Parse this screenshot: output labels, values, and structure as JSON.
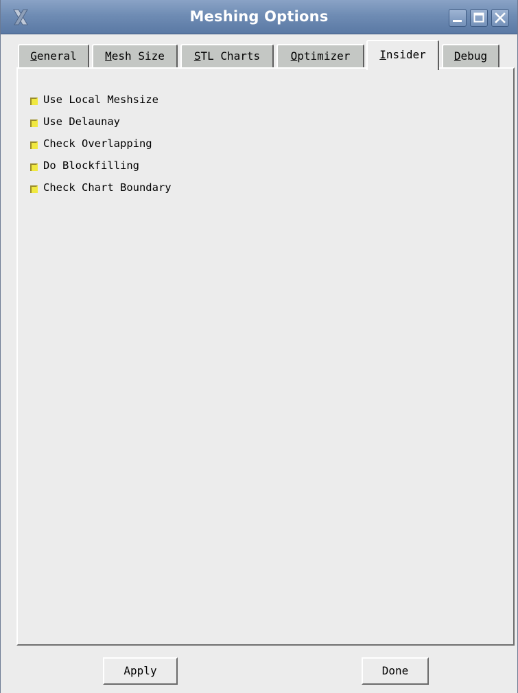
{
  "window": {
    "title": "Meshing Options"
  },
  "tabs": [
    {
      "pre": "",
      "acc": "G",
      "post": "eneral",
      "active": false
    },
    {
      "pre": "",
      "acc": "M",
      "post": "esh Size",
      "active": false
    },
    {
      "pre": "",
      "acc": "S",
      "post": "TL Charts",
      "active": false
    },
    {
      "pre": "",
      "acc": "O",
      "post": "ptimizer",
      "active": false
    },
    {
      "pre": "",
      "acc": "I",
      "post": "nsider",
      "active": true
    },
    {
      "pre": "",
      "acc": "D",
      "post": "ebug",
      "active": false
    }
  ],
  "insider_options": [
    {
      "label": "Use Local Meshsize",
      "checked": true
    },
    {
      "label": "Use Delaunay",
      "checked": true
    },
    {
      "label": "Check Overlapping",
      "checked": true
    },
    {
      "label": "Do Blockfilling",
      "checked": true
    },
    {
      "label": "Check Chart Boundary",
      "checked": true
    }
  ],
  "buttons": {
    "apply_label": "Apply",
    "done_label": "Done"
  },
  "colors": {
    "checkbox_fill": "#f0e840",
    "checkbox_shade": "#9a8c2a",
    "titlebar_accent": "#6f8cb4",
    "panel_bg": "#ececec",
    "inactive_tab_bg": "#c4c7c4"
  },
  "icons": {
    "app": "x-cross-app-icon",
    "minimize": "minimize-icon",
    "maximize": "maximize-icon",
    "close": "close-icon"
  }
}
